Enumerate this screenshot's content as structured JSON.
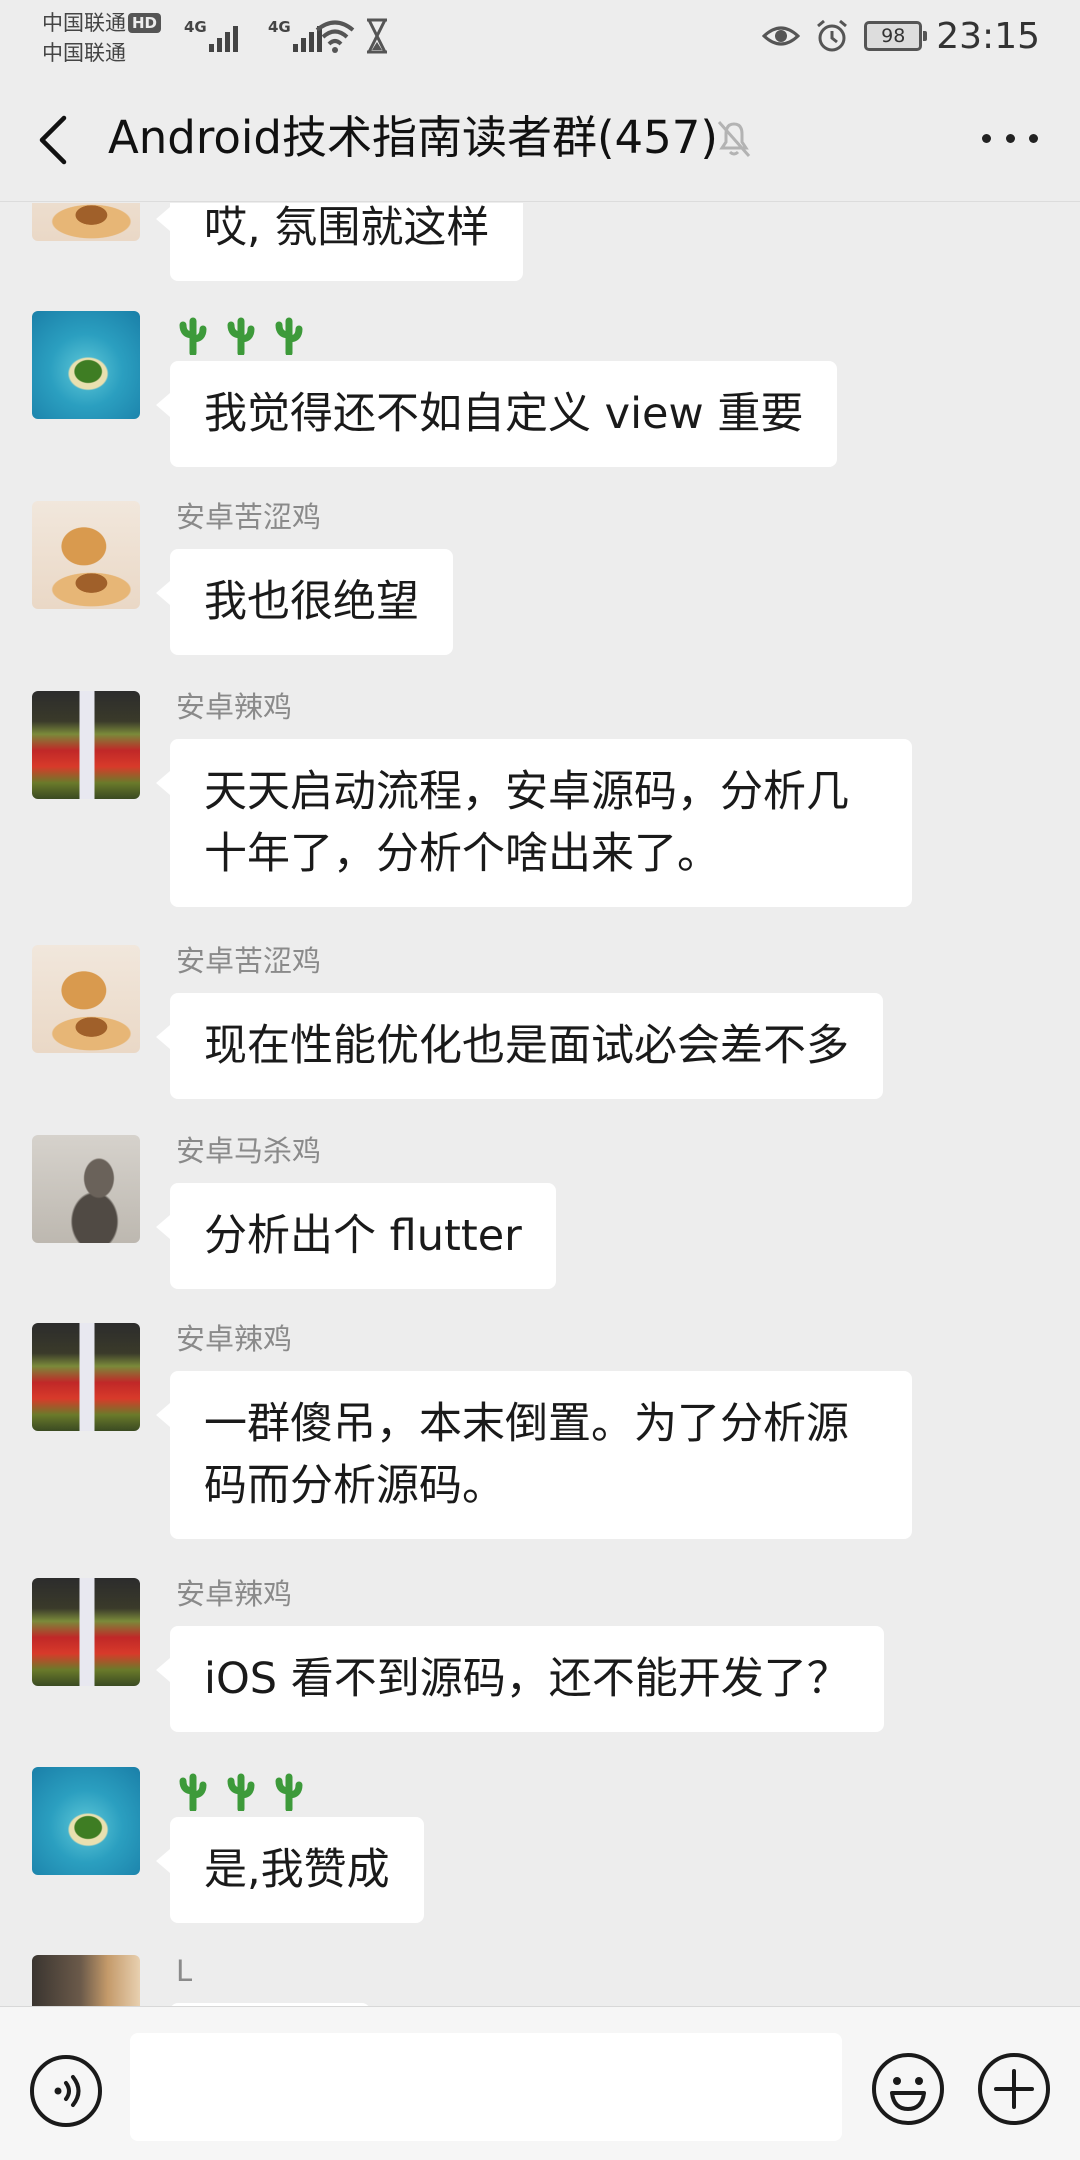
{
  "status_bar": {
    "carrier1": "中国联通",
    "carrier2": "中国联通",
    "hd_badge": "HD",
    "network1": "4G",
    "network2": "4G",
    "battery": "98",
    "time": "23:15"
  },
  "header": {
    "title": "Android技术指南读者群(457)",
    "muted": true
  },
  "messages": [
    {
      "sender": "",
      "text": "哎, 氛围就这样",
      "avatar": "dog-icon"
    },
    {
      "sender": "🌵🌵🌵",
      "text": "我觉得还不如自定义 view 重要",
      "avatar": "island-icon"
    },
    {
      "sender": "安卓苦涩鸡",
      "text": "我也很绝望",
      "avatar": "dog-icon"
    },
    {
      "sender": "安卓辣鸡",
      "text": "天天启动流程，安卓源码，分析几十年了，分析个啥出来了。",
      "avatar": "flowers-icon"
    },
    {
      "sender": "安卓苦涩鸡",
      "text": "现在性能优化也是面试必会差不多",
      "avatar": "dog-icon"
    },
    {
      "sender": "安卓马杀鸡",
      "text": "分析出个 flutter",
      "avatar": "dark-figure-icon"
    },
    {
      "sender": "安卓辣鸡",
      "text": "一群傻吊，本末倒置。为了分析源码而分析源码。",
      "avatar": "flowers-icon"
    },
    {
      "sender": "安卓辣鸡",
      "text": "iOS 看不到源码，还不能开发了？",
      "avatar": "flowers-icon"
    },
    {
      "sender": "🌵🌵🌵",
      "text": "是,我赞成",
      "avatar": "island-icon"
    },
    {
      "sender": "L",
      "text": "",
      "avatar": "person-icon"
    }
  ],
  "colors": {
    "background": "#ededed",
    "bubble": "#ffffff",
    "sender_name": "#8a8a8a",
    "cactus": "#3d9a3a"
  }
}
